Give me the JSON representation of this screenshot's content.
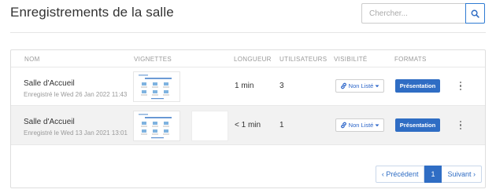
{
  "header": {
    "title": "Enregistrements de la salle",
    "search_placeholder": "Chercher..."
  },
  "table": {
    "columns": {
      "name": "NOM",
      "thumbnails": "VIGNETTES",
      "length": "LONGUEUR",
      "users": "UTILISATEURS",
      "visibility": "VISIBILITÉ",
      "formats": "FORMATS"
    },
    "rows": [
      {
        "name": "Salle d'Accueil",
        "recorded": "Enregistré le Wed 26 Jan 2022 11:43",
        "length": "1 min",
        "users": "3",
        "visibility": "Non Listé",
        "format": "Présentation"
      },
      {
        "name": "Salle d'Accueil",
        "recorded": "Enregistré le Wed 13 Jan 2021 13:01",
        "length": "< 1 min",
        "users": "1",
        "visibility": "Non Listé",
        "format": "Présentation"
      }
    ]
  },
  "pagination": {
    "previous": "‹ Précédent",
    "current": "1",
    "next": "Suivant ›"
  },
  "colors": {
    "accent": "#2f6dc4",
    "row_alt": "#f2f2f2"
  },
  "icons": {
    "search": "search-icon",
    "link": "link-icon",
    "caret": "caret-down-icon",
    "more": "more-vertical-icon"
  }
}
